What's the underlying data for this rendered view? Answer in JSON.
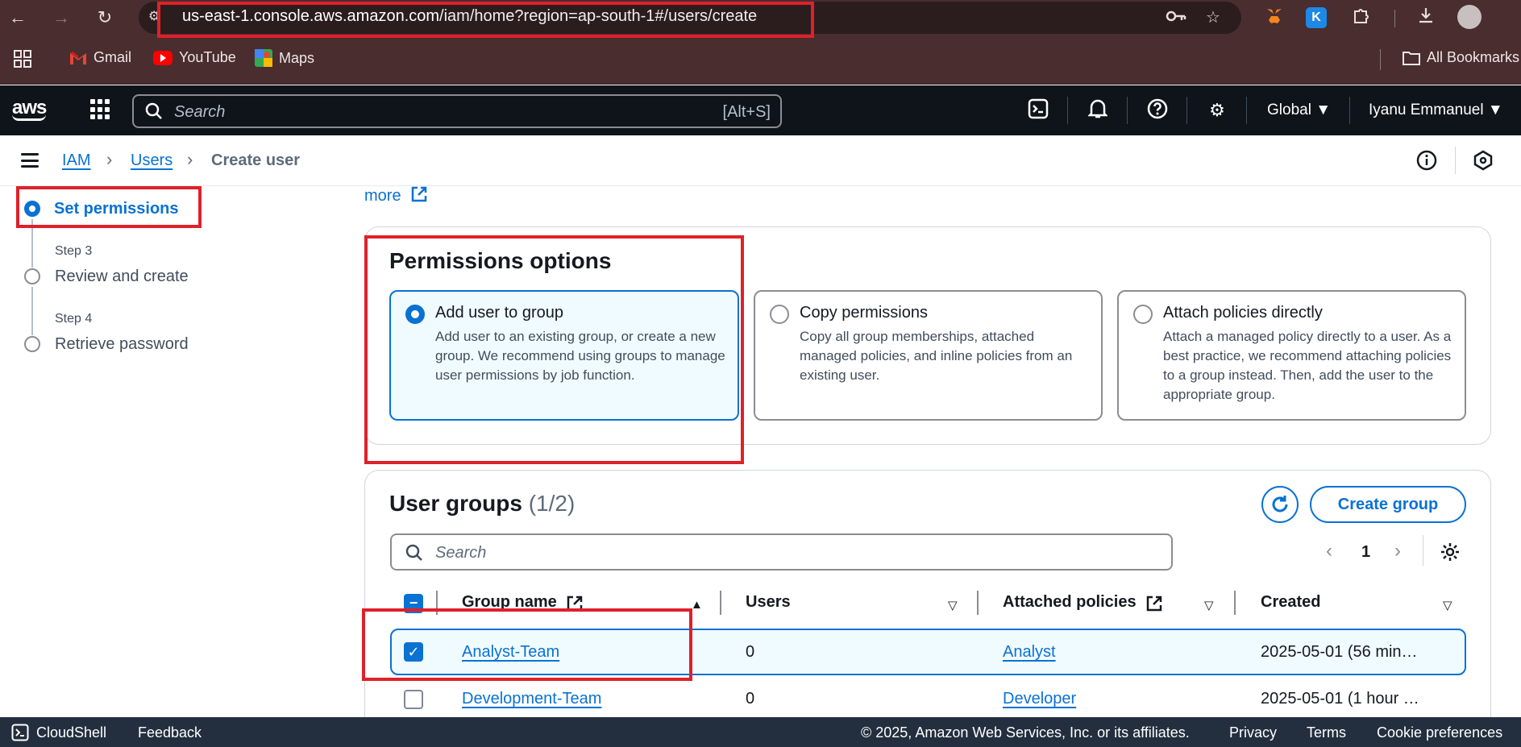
{
  "browser": {
    "url_host": "us-east-1.console.aws.amazon.com",
    "url_path": "/iam/home?region=ap-south-1#/users/create",
    "bookmarks": [
      {
        "label": "Gmail",
        "icon": "gmail-icon"
      },
      {
        "label": "YouTube",
        "icon": "youtube-icon"
      },
      {
        "label": "Maps",
        "icon": "maps-icon"
      }
    ],
    "all_bookmarks": "All Bookmarks"
  },
  "aws_nav": {
    "logo": "aws",
    "search_placeholder": "Search",
    "search_shortcut": "[Alt+S]",
    "region": "Global ▼",
    "account": "Iyanu Emmanuel ▼"
  },
  "breadcrumb": {
    "items": [
      "IAM",
      "Users"
    ],
    "current": "Create user",
    "separator": "›"
  },
  "steps": {
    "current": "Set permissions",
    "items": [
      {
        "label": "Step 3",
        "title": "Review and create"
      },
      {
        "label": "Step 4",
        "title": "Retrieve password"
      }
    ]
  },
  "main": {
    "more_link": "more",
    "permissions": {
      "title": "Permissions options",
      "options": [
        {
          "title": "Add user to group",
          "desc": "Add user to an existing group, or create a new group. We recommend using groups to manage user permissions by job function.",
          "selected": true
        },
        {
          "title": "Copy permissions",
          "desc": "Copy all group memberships, attached managed policies, and inline policies from an existing user.",
          "selected": false
        },
        {
          "title": "Attach policies directly",
          "desc": "Attach a managed policy directly to a user. As a best practice, we recommend attaching policies to a group instead. Then, add the user to the appropriate group.",
          "selected": false
        }
      ]
    },
    "groups": {
      "title": "User groups",
      "count": "(1/2)",
      "create_label": "Create group",
      "search_placeholder": "Search",
      "page": "1",
      "columns": [
        "Group name",
        "Users",
        "Attached policies",
        "Created"
      ],
      "rows": [
        {
          "name": "Analyst-Team",
          "users": "0",
          "policies": "Analyst",
          "created": "2025-05-01 (56 min…",
          "checked": true
        },
        {
          "name": "Development-Team",
          "users": "0",
          "policies": "Developer",
          "created": "2025-05-01 (1 hour …",
          "checked": false
        }
      ]
    }
  },
  "footer": {
    "cloudshell": "CloudShell",
    "feedback": "Feedback",
    "copyright": "© 2025, Amazon Web Services, Inc. or its affiliates.",
    "privacy": "Privacy",
    "terms": "Terms",
    "cookies": "Cookie preferences"
  },
  "colors": {
    "accent": "#0972d3",
    "annotation": "#e0202a",
    "nav_bg": "#0f141a",
    "browser_bg": "#4a2d2f"
  }
}
